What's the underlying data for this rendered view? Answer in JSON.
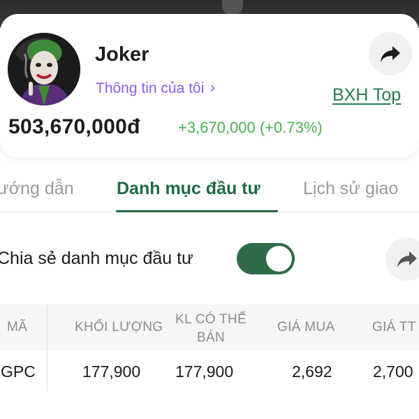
{
  "profile": {
    "name": "Joker",
    "profile_link": "Thông tin của tôi",
    "leaderboard_link": "BXH Top",
    "balance": "503,670,000đ",
    "change": "+3,670,000 (+0.73%)"
  },
  "tabs": [
    {
      "label": "ướng dẫn",
      "active": false
    },
    {
      "label": "Danh mục đầu tư",
      "active": true
    },
    {
      "label": "Lịch sử giao",
      "active": false
    }
  ],
  "share_portfolio": {
    "label": "Chia sẻ danh mục đầu tư",
    "enabled": true
  },
  "holdings_table": {
    "columns": [
      "MÃ",
      "KHỐI LƯỢNG",
      "KL CÓ THỂ",
      "BÁN",
      "GIÁ MUA",
      "GIÁ TT"
    ],
    "rows": [
      {
        "symbol": "GPC",
        "volume": "177,900",
        "sellable": "177,900",
        "buy_price": "2,692",
        "market_price": "2,700"
      }
    ]
  },
  "colors": {
    "accent_green": "#1f6b45",
    "positive_change": "#4caf50",
    "link_purple": "#8a5cf6"
  },
  "icons": [
    "share-arrow-icon",
    "chevron-right-icon",
    "avatar-image"
  ]
}
